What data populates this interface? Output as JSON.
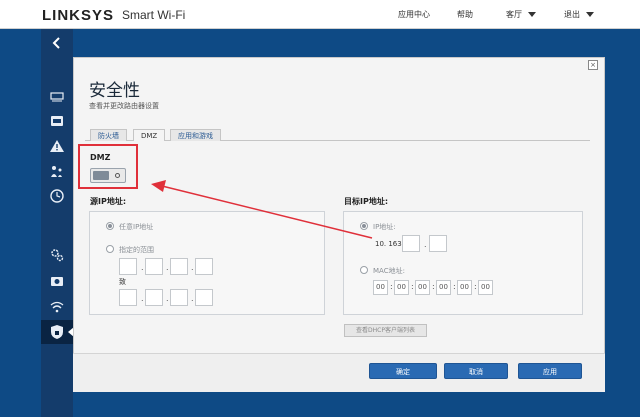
{
  "header": {
    "brand": "LINKSYS",
    "product": "Smart Wi-Fi",
    "nav": [
      "应用中心",
      "帮助",
      "客厅",
      "退出"
    ]
  },
  "sidebar": {
    "icons": [
      "device-icon",
      "router-icon",
      "warning-icon",
      "parental-icon",
      "clock-icon",
      "gear-icon",
      "camera-icon",
      "wifi-icon",
      "shield-icon"
    ]
  },
  "panel": {
    "title": "安全性",
    "subtitle": "查看并更改路由器设置",
    "close": "×",
    "tabs": [
      "防火墙",
      "DMZ",
      "应用和游戏"
    ]
  },
  "dmz": {
    "label": "DMZ",
    "enabled": false
  },
  "source": {
    "title": "源IP地址:",
    "any_ip": "任意IP地址",
    "range": "指定的范围",
    "to": "致"
  },
  "destination": {
    "title": "目标IP地址:",
    "ip_label": "IP地址:",
    "ip_prefix": "10. 163.",
    "mac_label": "MAC地址:",
    "mac": [
      "00",
      "00",
      "00",
      "00",
      "00",
      "00"
    ],
    "dhcp_button": "查看DHCP客户端列表"
  },
  "footer": {
    "ok": "确定",
    "cancel": "取消",
    "apply": "应用"
  },
  "colors": {
    "accent": "#2a6ab3",
    "highlight": "#e0303a",
    "background": "#0e4a85"
  }
}
